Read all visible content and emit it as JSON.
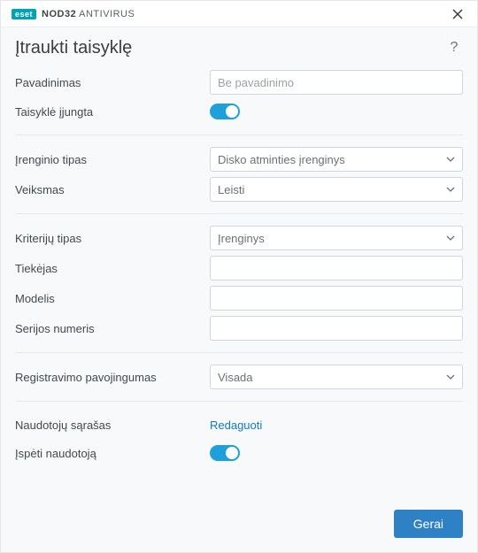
{
  "titlebar": {
    "brand_badge": "eset",
    "brand_product_strong": "NOD32",
    "brand_product_rest": "ANTIVIRUS"
  },
  "header": {
    "title": "Įtraukti taisyklę"
  },
  "fields": {
    "name_label": "Pavadinimas",
    "name_placeholder": "Be pavadinimo",
    "name_value": "",
    "rule_enabled_label": "Taisyklė įjungta",
    "device_type_label": "Įrenginio tipas",
    "device_type_value": "Disko atminties įrenginys",
    "action_label": "Veiksmas",
    "action_value": "Leisti",
    "criteria_type_label": "Kriterijų tipas",
    "criteria_type_value": "Įrenginys",
    "vendor_label": "Tiekėjas",
    "vendor_value": "",
    "model_label": "Modelis",
    "model_value": "",
    "serial_label": "Serijos numeris",
    "serial_value": "",
    "logging_label": "Registravimo pavojingumas",
    "logging_value": "Visada",
    "userlist_label": "Naudotojų sąrašas",
    "userlist_link": "Redaguoti",
    "notify_label": "Įspėti naudotoją"
  },
  "footer": {
    "ok_label": "Gerai"
  }
}
